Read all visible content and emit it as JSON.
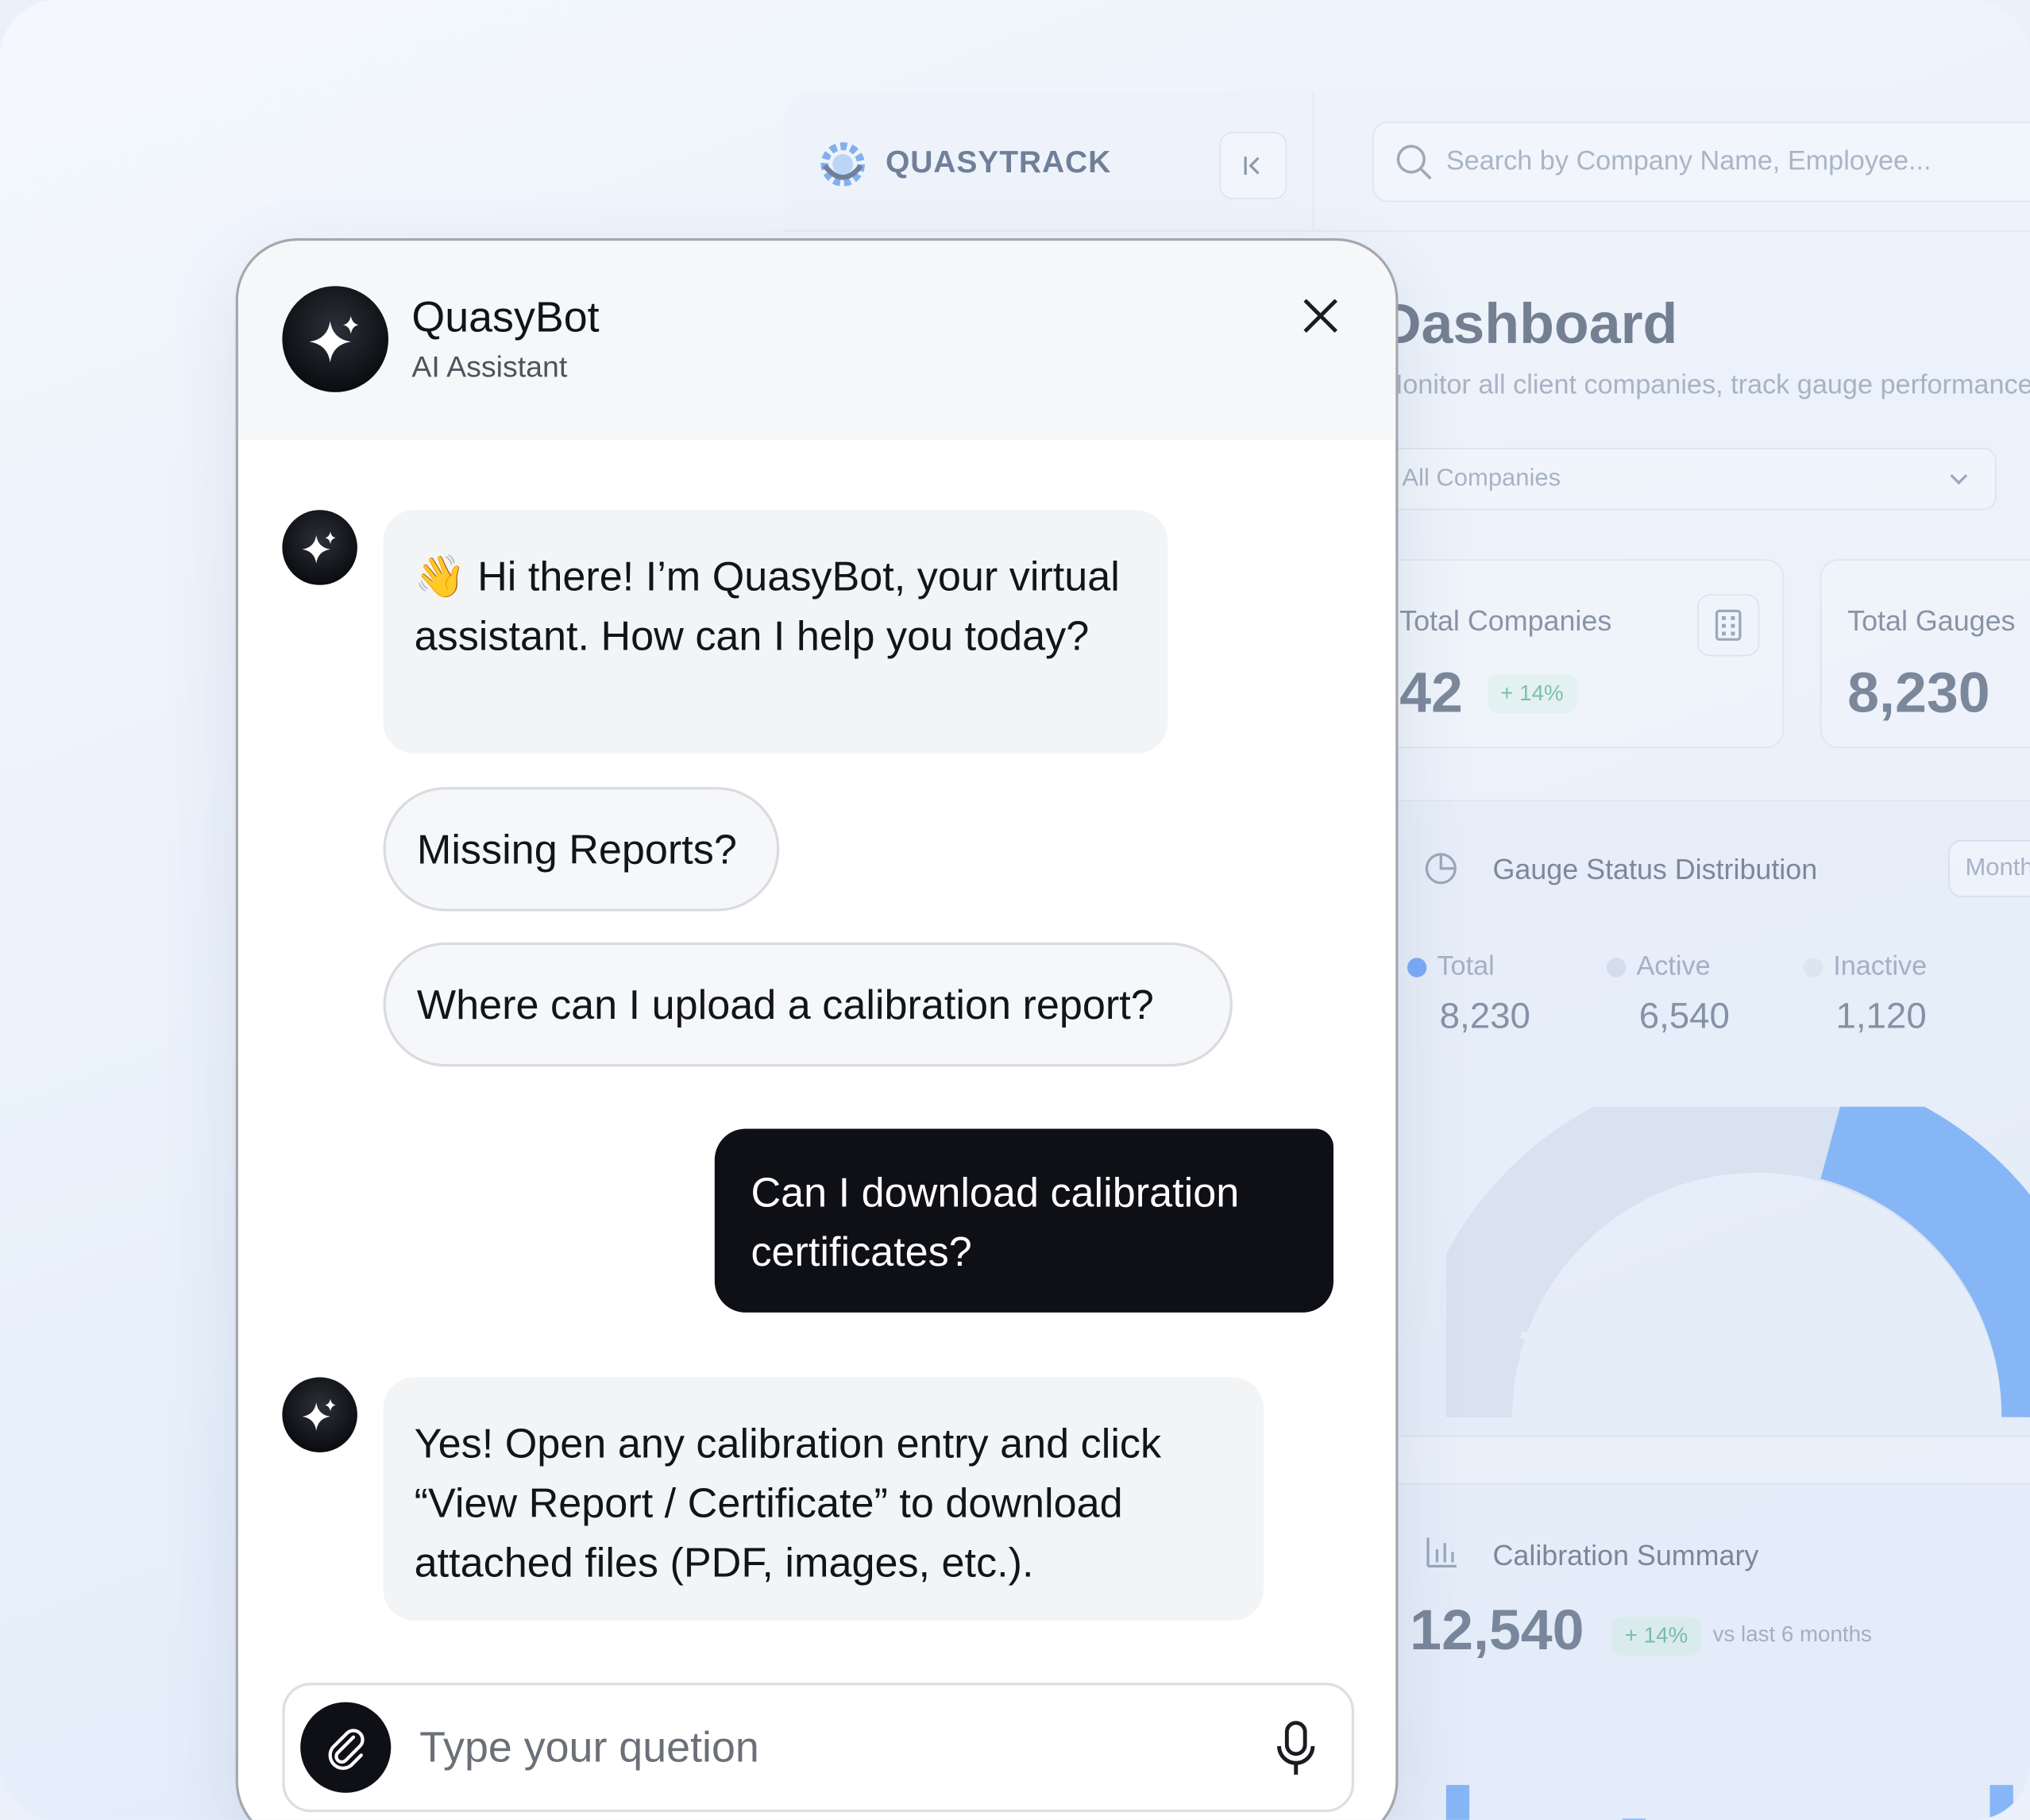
{
  "dashboard": {
    "brand": "QUASYTRACK",
    "search_placeholder": "Search by Company Name, Employee...",
    "title": "Dashboard",
    "subtitle": "Monitor all client companies, track gauge performance",
    "company_filter": "All Companies",
    "stats": [
      {
        "label": "Total Companies",
        "value": "42",
        "change": "+ 14%"
      },
      {
        "label": "Total Gauges",
        "value": "8,230"
      }
    ],
    "gauge_status": {
      "title": "Gauge Status Distribution",
      "period": "Monthly",
      "legend": [
        {
          "label": "Total",
          "value": "8,230",
          "color": "#3b82f6"
        },
        {
          "label": "Active",
          "value": "6,540",
          "color": "#c8d3e3"
        },
        {
          "label": "Inactive",
          "value": "1,120",
          "color": "#d6dfeb"
        }
      ]
    },
    "calibration_summary": {
      "title": "Calibration Summary",
      "value": "12,540",
      "change": "+ 14%",
      "note": "vs last 6 months"
    }
  },
  "chat": {
    "bot_name": "QuasyBot",
    "bot_role": "AI Assistant",
    "greeting": "👋 Hi there! I’m QuasyBot, your virtual assistant. How can I help you today?",
    "suggestions": [
      "Missing Reports?",
      "Where can I upload a calibration report?"
    ],
    "user_message": "Can I download calibration certificates?",
    "bot_reply": "Yes! Open any calibration entry and click “View Report / Certificate” to download attached files (PDF, images, etc.).",
    "input_placeholder": "Type your quetion"
  },
  "colors": {
    "bot_dark": "#0f1016",
    "bubble_bg": "#f3f4f6",
    "accent_blue": "#4f96f5",
    "positive_green": "#3aa27a"
  },
  "icons": [
    "logo-gear-icon",
    "collapse-sidebar-icon",
    "search-icon",
    "chevron-down-icon",
    "building-icon",
    "pie-chart-icon",
    "bar-chart-icon",
    "sparkle-icon",
    "close-icon",
    "paperclip-icon",
    "microphone-icon"
  ]
}
